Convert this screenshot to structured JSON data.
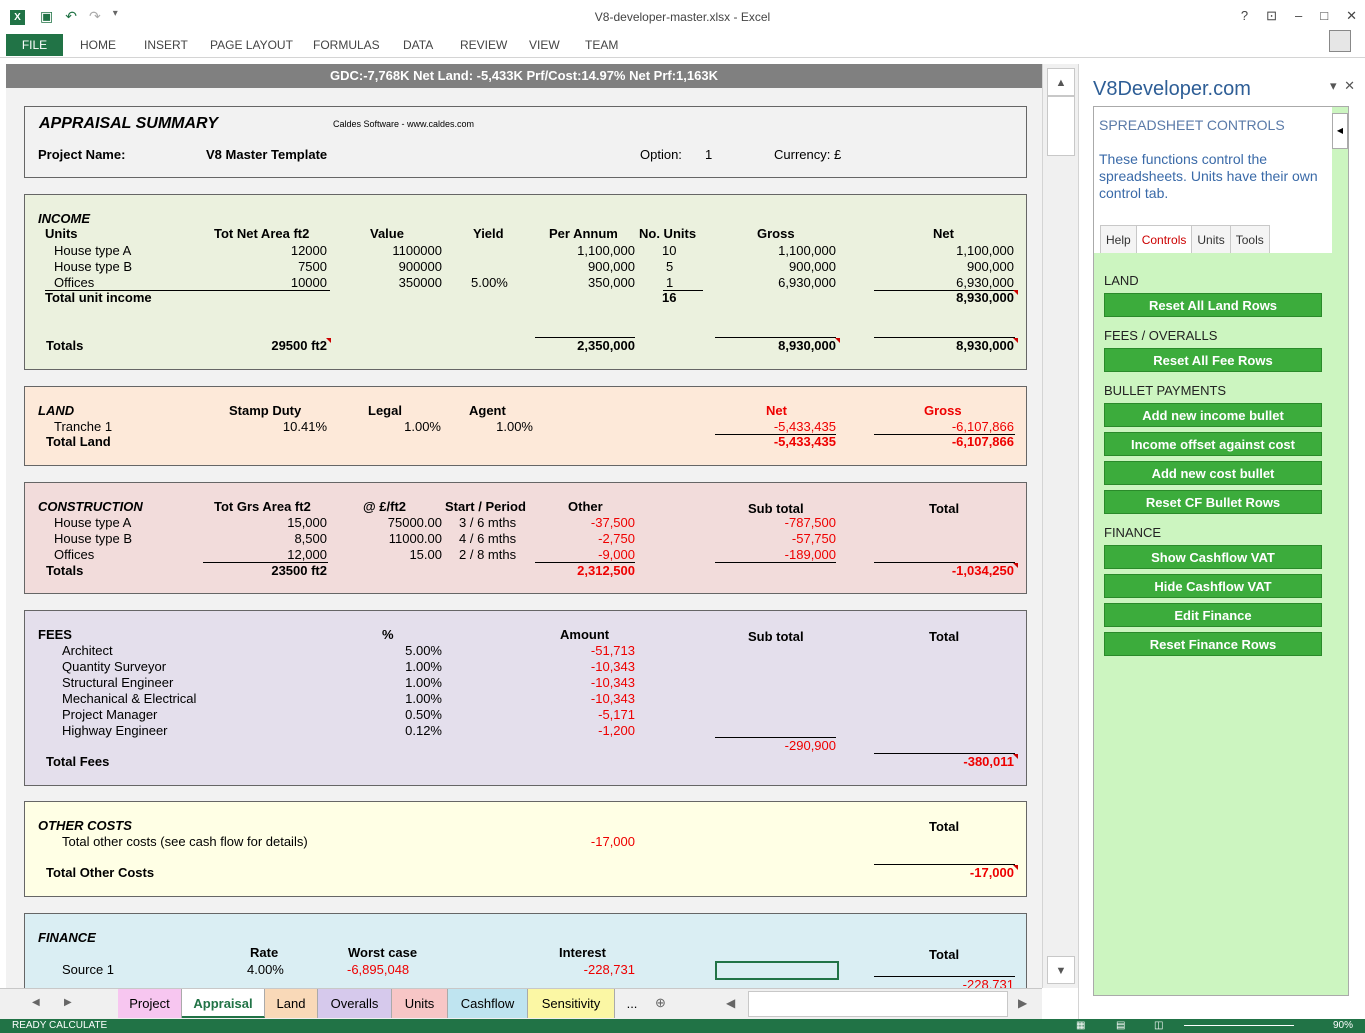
{
  "window": {
    "title": "V8-developer-master.xlsx - Excel",
    "controls": [
      "?",
      "⊡",
      "–",
      "□",
      "✕"
    ]
  },
  "ribbon": {
    "tabs": [
      "FILE",
      "HOME",
      "INSERT",
      "PAGE LAYOUT",
      "FORMULAS",
      "DATA",
      "REVIEW",
      "VIEW",
      "TEAM"
    ]
  },
  "summary_strip": "GDC:-7,768K   Net Land: -5,433K   Prf/Cost:14.97%   Net Prf:1,163K",
  "appraisal": {
    "title": "APPRAISAL SUMMARY",
    "credit": "Caldes Software - www.caldes.com",
    "project_label": "Project Name:",
    "project_name": "V8 Master Template",
    "option_label": "Option:",
    "option_value": "1",
    "currency": "Currency: £"
  },
  "income": {
    "heading": "INCOME",
    "units_label": "Units",
    "headers": [
      "Tot Net Area ft2",
      "Value",
      "Yield",
      "Per Annum",
      "No. Units",
      "Gross",
      "Net"
    ],
    "rows": [
      {
        "name": "House type A",
        "area": "12000",
        "value": "1100000",
        "yield": "",
        "per_annum": "1,100,000",
        "units": "10",
        "gross": "1,100,000",
        "net": "1,100,000"
      },
      {
        "name": "House type B",
        "area": "7500",
        "value": "900000",
        "yield": "",
        "per_annum": "900,000",
        "units": "5",
        "gross": "900,000",
        "net": "900,000"
      },
      {
        "name": "Offices",
        "area": "10000",
        "value": "350000",
        "yield": "5.00%",
        "per_annum": "350,000",
        "units": "1",
        "gross": "6,930,000",
        "net": "6,930,000"
      }
    ],
    "total_label": "Total unit income",
    "total_units": "16",
    "total_net": "8,930,000",
    "totals_label": "Totals",
    "totals_area": "29500 ft2",
    "totals_per_annum": "2,350,000",
    "totals_gross": "8,930,000",
    "totals_net": "8,930,000"
  },
  "land": {
    "heading": "LAND",
    "headers": [
      "Stamp Duty",
      "Legal",
      "Agent",
      "Net",
      "Gross"
    ],
    "row_name": "Tranche 1",
    "stamp": "10.41%",
    "legal": "1.00%",
    "agent": "1.00%",
    "net": "-5,433,435",
    "gross": "-6,107,866",
    "total_label": "Total Land",
    "total_net": "-5,433,435",
    "total_gross": "-6,107,866"
  },
  "construction": {
    "heading": "CONSTRUCTION",
    "headers": [
      "Tot Grs Area ft2",
      "@ £/ft2",
      "Start / Period",
      "Other",
      "Sub total",
      "Total"
    ],
    "rows": [
      {
        "name": "House type A",
        "area": "15,000",
        "rate": "75000.00",
        "period": "3 / 6 mths",
        "other": "-37,500",
        "sub": "-787,500"
      },
      {
        "name": "House type B",
        "area": "8,500",
        "rate": "11000.00",
        "period": "4 / 6 mths",
        "other": "-2,750",
        "sub": "-57,750"
      },
      {
        "name": "Offices",
        "area": "12,000",
        "rate": "15.00",
        "period": "2 / 8 mths",
        "other": "-9,000",
        "sub": "-189,000"
      }
    ],
    "totals_label": "Totals",
    "totals_area": "23500 ft2",
    "totals_other": "2,312,500",
    "total": "-1,034,250"
  },
  "fees": {
    "heading": "FEES",
    "headers": [
      "%",
      "Amount",
      "Sub total",
      "Total"
    ],
    "rows": [
      {
        "name": "Architect",
        "pct": "5.00%",
        "amount": "-51,713"
      },
      {
        "name": "Quantity Surveyor",
        "pct": "1.00%",
        "amount": "-10,343"
      },
      {
        "name": "Structural Engineer",
        "pct": "1.00%",
        "amount": "-10,343"
      },
      {
        "name": "Mechanical & Electrical",
        "pct": "1.00%",
        "amount": "-10,343"
      },
      {
        "name": "Project Manager",
        "pct": "0.50%",
        "amount": "-5,171"
      },
      {
        "name": "Highway Engineer",
        "pct": "0.12%",
        "amount": "-1,200"
      }
    ],
    "subtotal": "-290,900",
    "total_label": "Total Fees",
    "total": "-380,011"
  },
  "other_costs": {
    "heading": "OTHER COSTS",
    "total_header": "Total",
    "row_label": "Total other costs (see cash flow for details)",
    "row_amount": "-17,000",
    "total_label": "Total Other Costs",
    "total": "-17,000"
  },
  "finance": {
    "heading": "FINANCE",
    "headers": [
      "Rate",
      "Worst case",
      "Interest",
      "Total"
    ],
    "row_name": "Source 1",
    "rate": "4.00%",
    "worst": "-6,895,048",
    "interest": "-228,731",
    "total": "-228,731"
  },
  "sheet_tabs": [
    {
      "label": "Project",
      "color": "#f7c6f0"
    },
    {
      "label": "Appraisal",
      "color": "#ffffff"
    },
    {
      "label": "Land",
      "color": "#f9d9b8"
    },
    {
      "label": "Overalls",
      "color": "#d6c9ec"
    },
    {
      "label": "Units",
      "color": "#f7c6c6"
    },
    {
      "label": "Cashflow",
      "color": "#bfe4f0"
    },
    {
      "label": "Sensitivity",
      "color": "#fbf7a4"
    }
  ],
  "sheet_tabs_more": "...",
  "pane": {
    "title": "V8Developer.com",
    "section": "SPREADSHEET CONTROLS",
    "description": "These functions control the spreadsheets.  Units have their own control tab.",
    "tabs": [
      "Help",
      "Controls",
      "Units",
      "Tools"
    ],
    "groups": [
      {
        "label": "LAND",
        "buttons": [
          "Reset All Land Rows"
        ]
      },
      {
        "label": "FEES / OVERALLS",
        "buttons": [
          "Reset All Fee Rows"
        ]
      },
      {
        "label": "BULLET PAYMENTS",
        "buttons": [
          "Add new income bullet",
          "Income offset against cost",
          "Add new cost bullet",
          "Reset CF Bullet Rows"
        ]
      },
      {
        "label": "FINANCE",
        "buttons": [
          "Show Cashflow VAT",
          "Hide Cashflow VAT",
          "Edit Finance",
          "Reset Finance Rows"
        ]
      }
    ]
  },
  "statusbar": {
    "left": "READY   CALCULATE",
    "zoom": "90%"
  },
  "colors": {
    "excel_green": "#217346",
    "income_bg": "#ebf1de",
    "land_bg": "#fde9d9",
    "construction_bg": "#f2dcdb",
    "fees_bg": "#e4dfec",
    "other_bg": "#ffffe5",
    "finance_bg": "#daeef3",
    "button_green": "#3cac3c"
  }
}
